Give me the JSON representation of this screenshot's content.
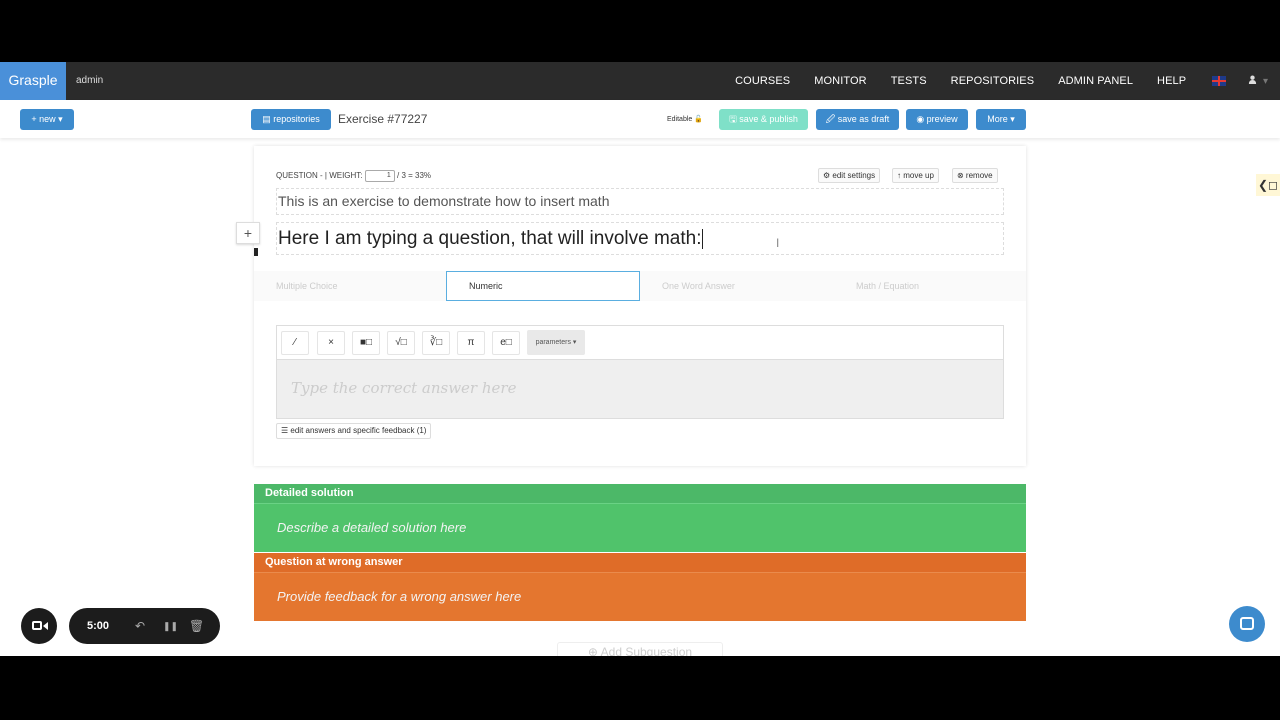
{
  "nav": {
    "brand": "Grasple",
    "user": "admin",
    "items": [
      "COURSES",
      "MONITOR",
      "TESTS",
      "REPOSITORIES",
      "ADMIN PANEL",
      "HELP"
    ],
    "user_caret": "▾"
  },
  "toolbar": {
    "new_label": "+ new ▾",
    "repositories_label": "▤ repositories",
    "exercise_title": "Exercise #77227",
    "editable_label": "Editable 🔓",
    "save_publish_label": "🖫 save & publish",
    "save_draft_label": "🖉 save as draft",
    "preview_label": "◉ preview",
    "more_label": "More ▾"
  },
  "question": {
    "meta_prefix": "QUESTION - | WEIGHT:",
    "weight_value": "1",
    "meta_suffix": "/ 3 = 33%",
    "edit_settings": "⚙ edit settings",
    "move_up": "↑ move up",
    "remove": "⊗ remove",
    "intro_text": "This is an exercise to demonstrate how to insert math",
    "question_text": "Here I am typing a question, that will involve math:",
    "add_label": "+"
  },
  "answer_tabs": {
    "items": [
      "Multiple Choice",
      "Numeric",
      "One Word Answer",
      "Math / Equation"
    ],
    "active": "Numeric"
  },
  "editor": {
    "buttons": [
      "⁄",
      "×",
      "■□",
      "√□",
      "∛□",
      "π",
      "e□"
    ],
    "parameters_label": "parameters ▾",
    "answer_placeholder": "Type the correct answer here",
    "feedback_button": "☰ edit answers and specific feedback (1)"
  },
  "sections": {
    "detailed_title": "Detailed solution",
    "detailed_placeholder": "Describe a detailed solution here",
    "wrong_title": "Question at wrong answer",
    "wrong_placeholder": "Provide feedback for a wrong answer here",
    "add_subquestion": "⊕ Add Subquestion"
  },
  "recording": {
    "time": "5:00",
    "undo_icon": "↶",
    "pause_icon": "❚❚",
    "trash_icon": "🗑"
  },
  "side_tab_label": "❮◻",
  "colors": {
    "brand": "#4a90d9",
    "primary": "#3d8bcd",
    "success": "#50c36b",
    "warning": "#e4762f",
    "active_tab_border": "#5aaee0"
  }
}
